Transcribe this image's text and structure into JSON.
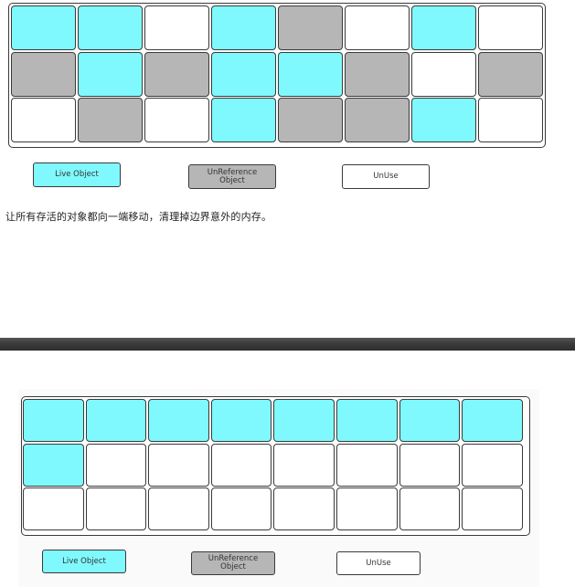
{
  "legend": {
    "live": "Live Object",
    "unref": "UnReference\nObject",
    "unuse": "UnUse"
  },
  "caption": "让所有存活的对象都向一端移动，清理掉边界意外的内存。",
  "colors": {
    "live": "#7ff9fd",
    "unref": "#b6b6b6",
    "unuse": "#ffffff",
    "border": "#3a3a3a",
    "divider": "#3b3b3b"
  },
  "before": {
    "rows": [
      [
        "live",
        "live",
        "unuse",
        "live",
        "unref",
        "unuse",
        "live",
        "unuse"
      ],
      [
        "unref",
        "live",
        "unref",
        "live",
        "live",
        "unref",
        "unuse",
        "unref"
      ],
      [
        "unuse",
        "unref",
        "unuse",
        "live",
        "unref",
        "unref",
        "live",
        "unuse"
      ]
    ]
  },
  "after": {
    "rows": [
      [
        "live",
        "live",
        "live",
        "live",
        "live",
        "live",
        "live",
        "live"
      ],
      [
        "live",
        "unuse",
        "unuse",
        "unuse",
        "unuse",
        "unuse",
        "unuse",
        "unuse"
      ],
      [
        "unuse",
        "unuse",
        "unuse",
        "unuse",
        "unuse",
        "unuse",
        "unuse",
        "unuse"
      ]
    ]
  }
}
